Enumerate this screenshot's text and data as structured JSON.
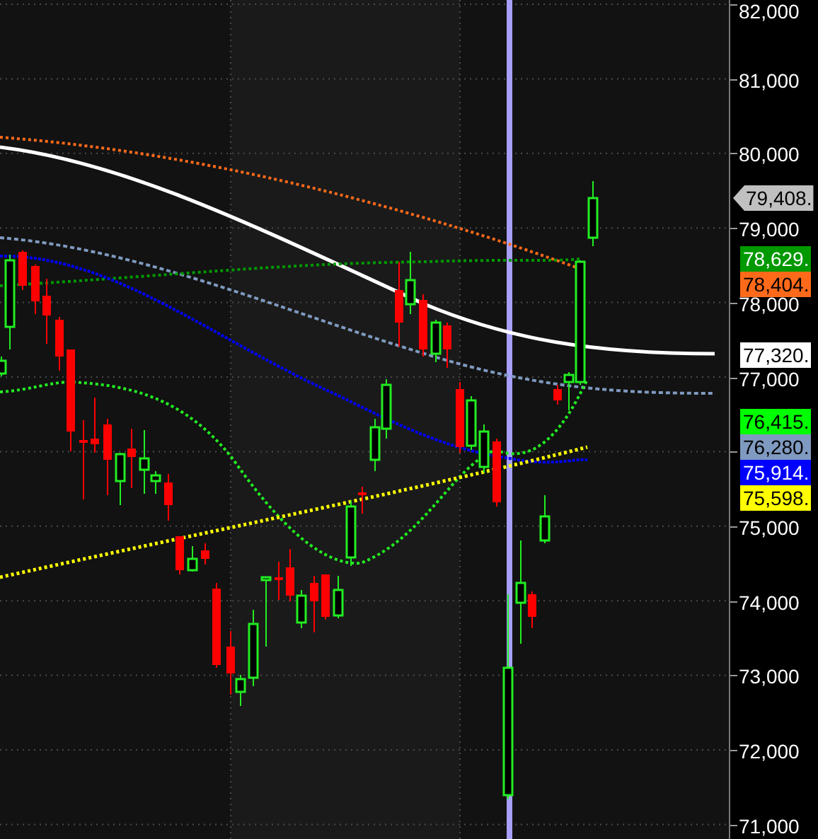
{
  "chart": {
    "price_axis": {
      "ticks": [
        "82,000",
        "81,000",
        "80,000",
        "79,000",
        "78,000",
        "77,000",
        "75,000",
        "74,000",
        "73,000",
        "72,000",
        "71,000"
      ]
    },
    "price_tags": [
      {
        "kind": "last",
        "label": "79,408.",
        "color": "#c0c0c0"
      },
      {
        "kind": "indicator",
        "label": "78,629.",
        "color": "#009900"
      },
      {
        "kind": "indicator",
        "label": "78,404.",
        "color": "#ff6a1a"
      },
      {
        "kind": "indicator",
        "label": "77,320.",
        "color": "#ffffff"
      },
      {
        "kind": "indicator",
        "label": "76,415.",
        "color": "#00ff00"
      },
      {
        "kind": "indicator",
        "label": "76,280.",
        "color": "#7f9ac0"
      },
      {
        "kind": "indicator",
        "label": "75,914.",
        "color": "#0000ff"
      },
      {
        "kind": "indicator",
        "label": "75,598.",
        "color": "#ffff00"
      }
    ]
  }
}
